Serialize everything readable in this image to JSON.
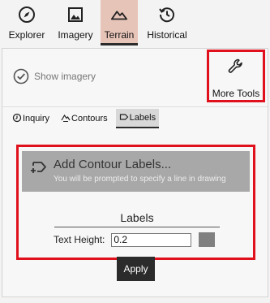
{
  "nav": {
    "items": [
      {
        "label": "Explorer",
        "icon": "compass-icon"
      },
      {
        "label": "Imagery",
        "icon": "image-icon"
      },
      {
        "label": "Terrain",
        "icon": "mountain-icon",
        "active": true
      },
      {
        "label": "Historical",
        "icon": "history-icon"
      }
    ]
  },
  "toolbar": {
    "show_imagery": "Show imagery",
    "more_tools": "More Tools"
  },
  "subtabs": [
    {
      "label": "Inquiry",
      "icon": "inquiry-icon"
    },
    {
      "label": "Contours",
      "icon": "contours-icon"
    },
    {
      "label": "Labels",
      "icon": "label-tag-icon",
      "active": true
    }
  ],
  "labels_panel": {
    "add_title": "Add Contour Labels...",
    "add_subtitle": "You will be prompted to specify a line in drawing",
    "section_title": "Labels",
    "text_height_label": "Text Height:",
    "text_height_value": "0.2",
    "color": "#808080"
  },
  "apply_label": "Apply",
  "colors": {
    "accent_active_tab": "#e7c4b8",
    "highlight_border": "#e0101c",
    "add_button_bg": "#a8a8a8",
    "apply_bg": "#2b2b2b"
  }
}
